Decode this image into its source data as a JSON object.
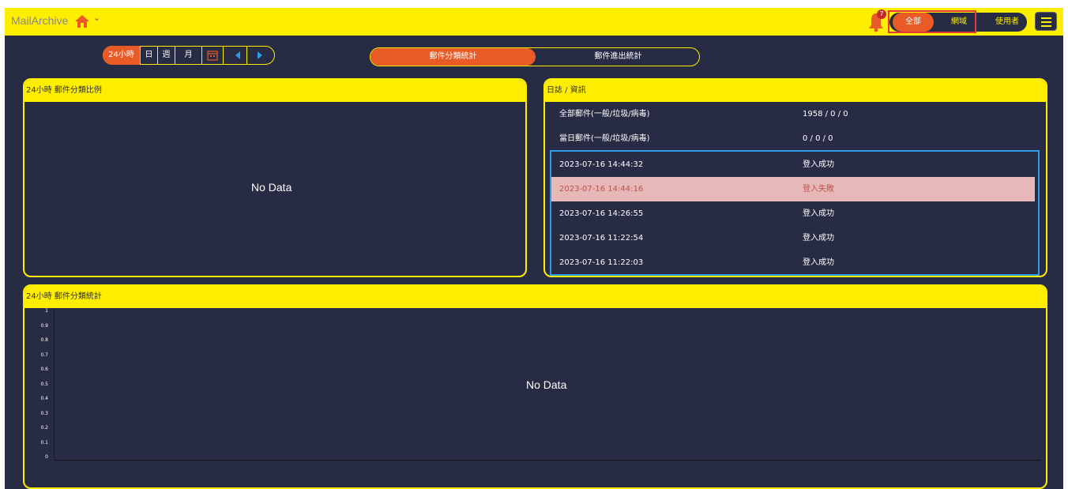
{
  "topbar": {
    "brand": "MailArchive",
    "notification_count": "7",
    "scope_buttons": [
      "全部",
      "網域",
      "使用者"
    ]
  },
  "range": {
    "buttons": [
      "24小時",
      "日",
      "週",
      "月"
    ]
  },
  "tabs": [
    "郵件分類統計",
    "郵件進出統計"
  ],
  "pie_panel": {
    "title": "24小時 郵件分類比例",
    "empty_text": "No Data"
  },
  "log_panel": {
    "title": "日誌 / 資訊",
    "summary": [
      {
        "label": "全部郵件(一般/垃圾/病毒)",
        "value": "1958 / 0 / 0"
      },
      {
        "label": "當日郵件(一般/垃圾/病毒)",
        "value": "0 / 0 / 0"
      }
    ],
    "logs": [
      {
        "time": "2023-07-16 14:44:32",
        "status": "登入成功",
        "failed": false
      },
      {
        "time": "2023-07-16 14:44:16",
        "status": "登入失敗",
        "failed": true
      },
      {
        "time": "2023-07-16 14:26:55",
        "status": "登入成功",
        "failed": false
      },
      {
        "time": "2023-07-16 11:22:54",
        "status": "登入成功",
        "failed": false
      },
      {
        "time": "2023-07-16 11:22:03",
        "status": "登入成功",
        "failed": false
      }
    ]
  },
  "chart_panel": {
    "title": "24小時 郵件分類統計",
    "empty_text": "No Data"
  },
  "chart_data": {
    "type": "bar",
    "title": "24小時 郵件分類統計",
    "ylim": [
      0,
      1
    ],
    "yticks": [
      "1",
      "0.9",
      "0.8",
      "0.7",
      "0.6",
      "0.5",
      "0.4",
      "0.3",
      "0.2",
      "0.1",
      "0"
    ],
    "series": []
  },
  "colors": {
    "accent_yellow": "#ffee00",
    "accent_orange": "#e85a26",
    "background": "#272b44",
    "fail_row": "#e6b8b7",
    "highlight_border": "#2e9ce6"
  }
}
